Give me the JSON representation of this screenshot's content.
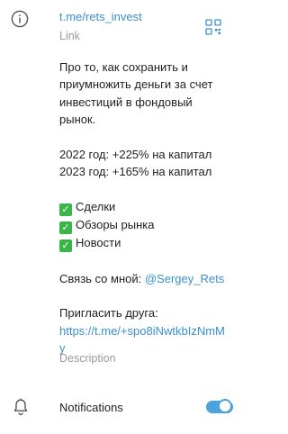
{
  "info": {
    "icon": "info-icon",
    "link": "t.me/rets_invest",
    "link_label": "Link",
    "qr_icon": "qr-code-icon"
  },
  "description": {
    "lines": [
      "Про то, как сохранить и",
      "приумножить деньги за счет",
      "инвестиций в фондовый",
      "рынок."
    ],
    "stats": [
      "2022 год: +225% на капитал",
      "2023 год: +165% на капитал"
    ],
    "checklist": [
      "Сделки",
      "Обзоры рынка",
      "Новости"
    ],
    "contact_prefix": "Связь со мной: ",
    "contact_handle": "@Sergey_Rets",
    "invite_label": "Пригласить друга:",
    "invite_url": "https://t.me/+spo8iNwtkbIzNmMy",
    "label": "Description"
  },
  "notifications": {
    "icon": "bell-icon",
    "label": "Notifications",
    "enabled": true
  },
  "colors": {
    "accent": "#3a8fd1",
    "toggle": "#4aa3df",
    "check": "#3ab54a"
  }
}
